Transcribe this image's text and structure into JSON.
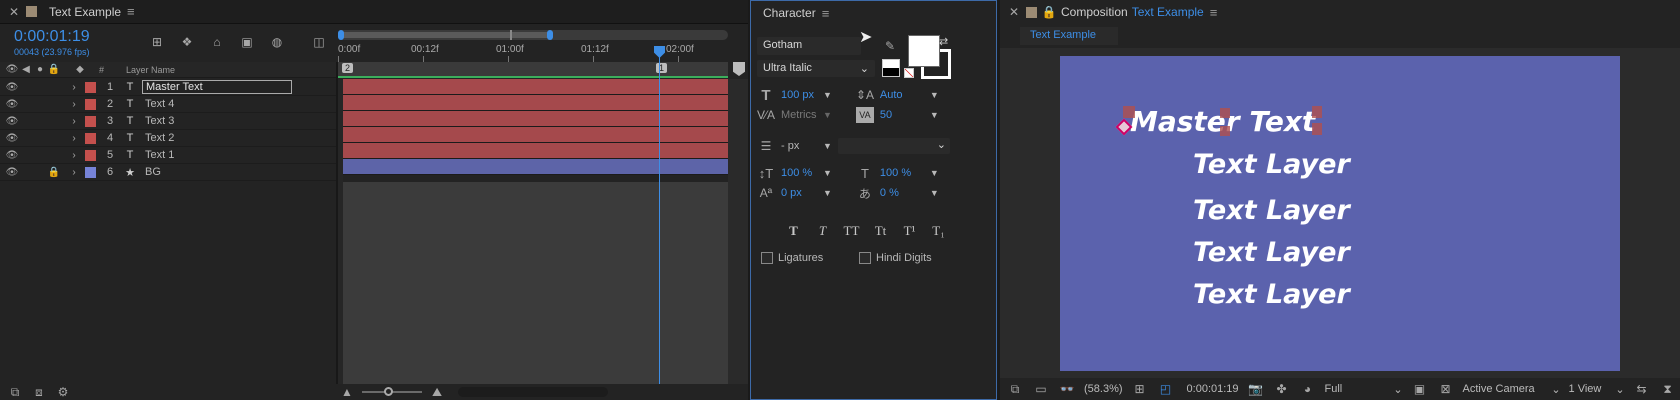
{
  "timeline": {
    "tab_title": "Text Example",
    "timecode": "0:00:01:19",
    "frame_info": "00043 (23.976 fps)",
    "layer_name_header": "Layer Name",
    "hash_header": "#",
    "ruler_ticks": [
      "0:00f",
      "00:12f",
      "01:00f",
      "01:12f",
      "02:00f"
    ],
    "marker_start": "2",
    "marker_end": "1",
    "layers": [
      {
        "num": "1",
        "type": "T",
        "name": "Master Text",
        "label_color": "#c4504d",
        "bar_color": "#a5494c",
        "selected": true
      },
      {
        "num": "2",
        "type": "T",
        "name": "Text 4",
        "label_color": "#c4504d",
        "bar_color": "#a5494c"
      },
      {
        "num": "3",
        "type": "T",
        "name": "Text 3",
        "label_color": "#c4504d",
        "bar_color": "#a5494c"
      },
      {
        "num": "4",
        "type": "T",
        "name": "Text 2",
        "label_color": "#c4504d",
        "bar_color": "#a5494c"
      },
      {
        "num": "5",
        "type": "T",
        "name": "Text 1",
        "label_color": "#c4504d",
        "bar_color": "#a5494c"
      },
      {
        "num": "6",
        "type": "★",
        "name": "BG",
        "label_color": "#7683d8",
        "bar_color": "#5d64a8"
      }
    ]
  },
  "character": {
    "title": "Character",
    "font_family": "Gotham",
    "font_style": "Ultra Italic",
    "font_size": "100 px",
    "leading": "Auto",
    "kerning": "Metrics",
    "tracking": "50",
    "stroke_width": "- px",
    "vscale": "100 %",
    "hscale": "100 %",
    "baseline": "0 px",
    "tsume": "0 %",
    "typo_buttons": [
      "T",
      "T",
      "TT",
      "Tt",
      "T¹",
      "T₁"
    ],
    "ligatures": "Ligatures",
    "hindi_digits": "Hindi Digits",
    "fill_color": "#ffffff"
  },
  "composition": {
    "tab_prefix": "Composition",
    "tab_name": "Text Example",
    "sub_tab": "Text Example",
    "bg_color": "#5b62ad",
    "master_text": "Master Text",
    "layer_texts": [
      "Text Layer",
      "Text Layer",
      "Text Layer",
      "Text Layer"
    ],
    "zoom": "(58.3%)",
    "timecode": "0:00:01:19",
    "resolution": "Full",
    "camera": "Active Camera",
    "view": "1 View"
  }
}
